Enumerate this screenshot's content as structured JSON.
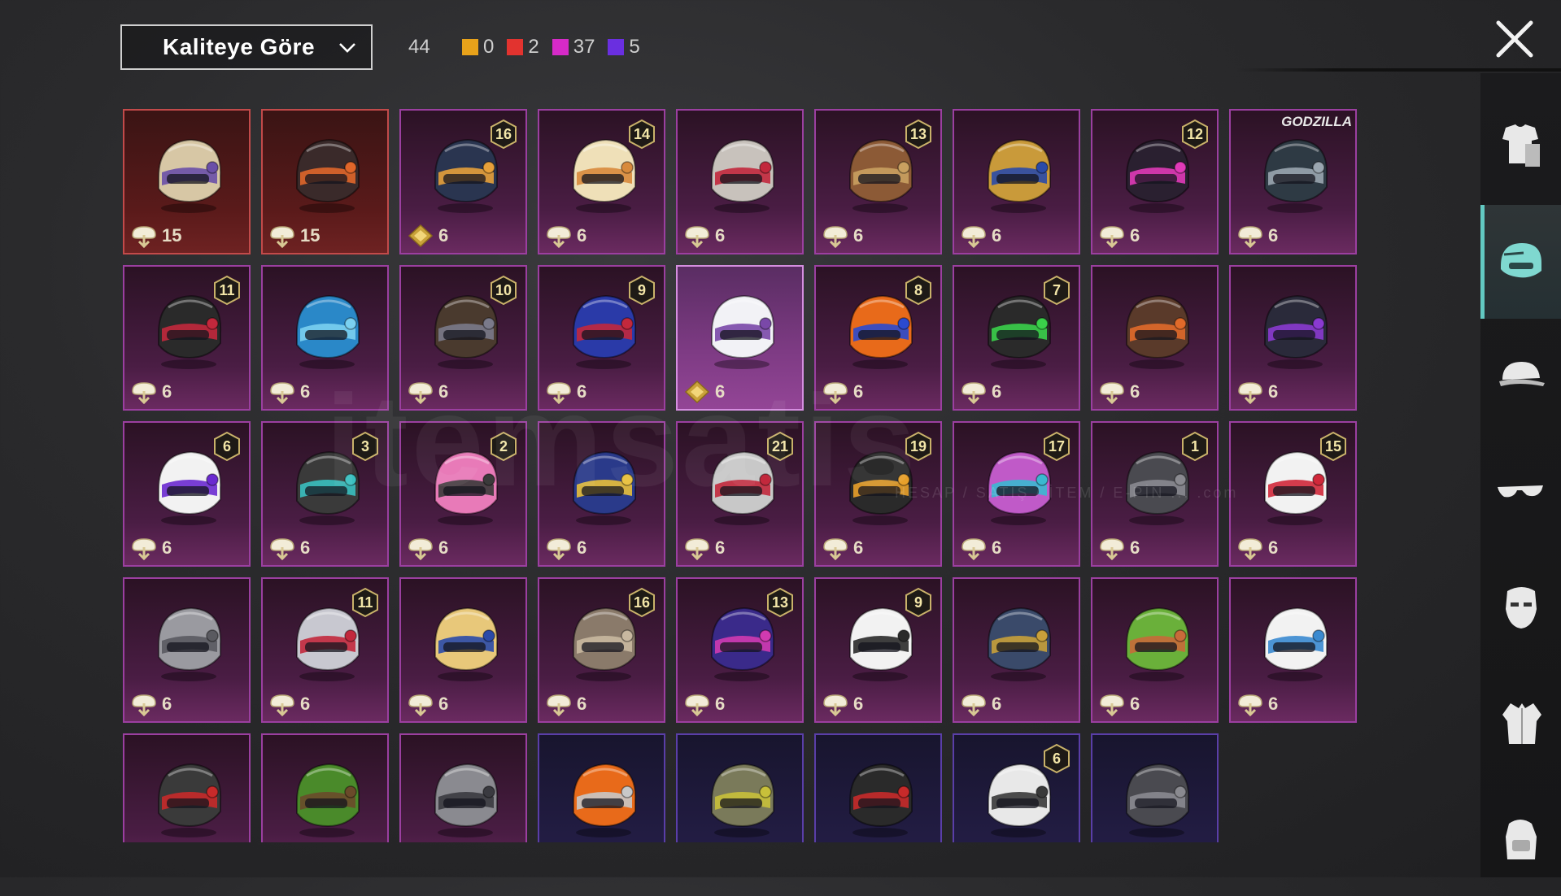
{
  "sort": {
    "label": "Kaliteye Göre"
  },
  "total_count": "44",
  "counts": [
    {
      "color": "#e8a21a",
      "value": "0"
    },
    {
      "color": "#e2332f",
      "value": "2"
    },
    {
      "color": "#d62ac8",
      "value": "37"
    },
    {
      "color": "#6a2fe0",
      "value": "5"
    }
  ],
  "items": [
    {
      "rarity": "red",
      "price": "15",
      "currency": "crate",
      "level": "",
      "colors": [
        "#d7c7a5",
        "#6a4fa8"
      ]
    },
    {
      "rarity": "red",
      "price": "15",
      "currency": "crate",
      "level": "",
      "colors": [
        "#3a2a2a",
        "#e0662a"
      ]
    },
    {
      "rarity": "purple",
      "price": "6",
      "currency": "diamond",
      "level": "16",
      "colors": [
        "#2a3550",
        "#e6a03a"
      ]
    },
    {
      "rarity": "purple",
      "price": "6",
      "currency": "crate",
      "level": "14",
      "colors": [
        "#efe0b8",
        "#d88a3c"
      ]
    },
    {
      "rarity": "purple",
      "price": "6",
      "currency": "crate",
      "level": "",
      "colors": [
        "#c8c2bc",
        "#c2283c"
      ]
    },
    {
      "rarity": "purple",
      "price": "6",
      "currency": "crate",
      "level": "13",
      "colors": [
        "#8c5a36",
        "#c9a060"
      ]
    },
    {
      "rarity": "purple",
      "price": "6",
      "currency": "crate",
      "level": "",
      "colors": [
        "#c99a3a",
        "#2a4aa8"
      ]
    },
    {
      "rarity": "purple",
      "price": "6",
      "currency": "crate",
      "level": "12",
      "colors": [
        "#2a2030",
        "#e03ab8"
      ]
    },
    {
      "rarity": "purple",
      "price": "6",
      "currency": "crate",
      "level": "",
      "brand": "GODZILLA",
      "colors": [
        "#2e3a44",
        "#9aa6b0"
      ]
    },
    {
      "rarity": "purple",
      "price": "6",
      "currency": "crate",
      "level": "11",
      "colors": [
        "#2a2a2a",
        "#c2283c"
      ]
    },
    {
      "rarity": "purple",
      "price": "6",
      "currency": "crate",
      "level": "",
      "colors": [
        "#2a88c8",
        "#7ad0f0"
      ]
    },
    {
      "rarity": "purple",
      "price": "6",
      "currency": "crate",
      "level": "10",
      "colors": [
        "#4a3a2e",
        "#7a7a8a"
      ]
    },
    {
      "rarity": "purple",
      "price": "6",
      "currency": "crate",
      "level": "9",
      "colors": [
        "#2a3aa8",
        "#c2283c"
      ]
    },
    {
      "rarity": "purple",
      "price": "6",
      "currency": "diamond",
      "level": "",
      "selected": true,
      "colors": [
        "#f2f2f6",
        "#7a48a8"
      ]
    },
    {
      "rarity": "purple",
      "price": "6",
      "currency": "crate",
      "level": "8",
      "colors": [
        "#e86a1a",
        "#2a4ad0"
      ]
    },
    {
      "rarity": "purple",
      "price": "6",
      "currency": "crate",
      "level": "7",
      "colors": [
        "#2a2a2a",
        "#3ad04a"
      ]
    },
    {
      "rarity": "purple",
      "price": "6",
      "currency": "crate",
      "level": "",
      "colors": [
        "#5a3a2a",
        "#e06a2a"
      ]
    },
    {
      "rarity": "purple",
      "price": "6",
      "currency": "crate",
      "level": "",
      "colors": [
        "#2a2a3a",
        "#8a3ad0"
      ]
    },
    {
      "rarity": "purple",
      "price": "6",
      "currency": "crate",
      "level": "6",
      "colors": [
        "#f2f2f2",
        "#6a2ad0"
      ]
    },
    {
      "rarity": "purple",
      "price": "6",
      "currency": "crate",
      "level": "3",
      "colors": [
        "#3a3a3a",
        "#3ac0c0"
      ]
    },
    {
      "rarity": "purple",
      "price": "6",
      "currency": "crate",
      "level": "2",
      "colors": [
        "#e87ab8",
        "#3a3a3a"
      ]
    },
    {
      "rarity": "purple",
      "price": "6",
      "currency": "crate",
      "level": "",
      "colors": [
        "#2a3a8a",
        "#e8c03a"
      ]
    },
    {
      "rarity": "purple",
      "price": "6",
      "currency": "crate",
      "level": "21",
      "colors": [
        "#c8c8c8",
        "#c2283c"
      ]
    },
    {
      "rarity": "purple",
      "price": "6",
      "currency": "crate",
      "level": "19",
      "colors": [
        "#2a2a2a",
        "#e8a02a"
      ]
    },
    {
      "rarity": "purple",
      "price": "6",
      "currency": "crate",
      "level": "17",
      "colors": [
        "#c05ac8",
        "#3ab8d0"
      ]
    },
    {
      "rarity": "purple",
      "price": "6",
      "currency": "crate",
      "level": "1",
      "colors": [
        "#4a4a50",
        "#8a8a90"
      ]
    },
    {
      "rarity": "purple",
      "price": "6",
      "currency": "crate",
      "level": "15",
      "colors": [
        "#f2f2f2",
        "#d0283a"
      ]
    },
    {
      "rarity": "purple",
      "price": "6",
      "currency": "crate",
      "level": "",
      "colors": [
        "#9a9aa0",
        "#5a5a60"
      ]
    },
    {
      "rarity": "purple",
      "price": "6",
      "currency": "crate",
      "level": "11",
      "colors": [
        "#c8c8d0",
        "#c2283c"
      ]
    },
    {
      "rarity": "purple",
      "price": "6",
      "currency": "crate",
      "level": "",
      "colors": [
        "#e8c87a",
        "#2a4aa8"
      ]
    },
    {
      "rarity": "purple",
      "price": "6",
      "currency": "crate",
      "level": "16",
      "colors": [
        "#8a7a6a",
        "#c8b8a0"
      ]
    },
    {
      "rarity": "purple",
      "price": "6",
      "currency": "crate",
      "level": "13",
      "colors": [
        "#3a2a8a",
        "#d03ab0"
      ]
    },
    {
      "rarity": "purple",
      "price": "6",
      "currency": "crate",
      "level": "9",
      "colors": [
        "#f2f2f2",
        "#2a2a2a"
      ]
    },
    {
      "rarity": "purple",
      "price": "6",
      "currency": "crate",
      "level": "",
      "colors": [
        "#3a4a6a",
        "#c8a03a"
      ]
    },
    {
      "rarity": "purple",
      "price": "6",
      "currency": "crate",
      "level": "",
      "colors": [
        "#6ab03a",
        "#c86a3a"
      ]
    },
    {
      "rarity": "purple",
      "price": "6",
      "currency": "crate",
      "level": "",
      "colors": [
        "#f2f2f2",
        "#3a8ad0"
      ]
    },
    {
      "rarity": "purple",
      "price": "",
      "currency": "",
      "level": "",
      "colors": [
        "#3a3a3a",
        "#c82a2a"
      ]
    },
    {
      "rarity": "purple",
      "price": "",
      "currency": "",
      "level": "",
      "colors": [
        "#4a8a2a",
        "#6a4a2a"
      ]
    },
    {
      "rarity": "purple",
      "price": "",
      "currency": "",
      "level": "",
      "colors": [
        "#8a8a90",
        "#3a3a40"
      ]
    },
    {
      "rarity": "blue",
      "price": "",
      "currency": "",
      "level": "",
      "colors": [
        "#e86a1a",
        "#c8c8c8"
      ]
    },
    {
      "rarity": "blue",
      "price": "",
      "currency": "",
      "level": "",
      "colors": [
        "#7a7a5a",
        "#c8c03a"
      ]
    },
    {
      "rarity": "blue",
      "price": "",
      "currency": "",
      "level": "",
      "colors": [
        "#2a2a2a",
        "#c82a2a"
      ]
    },
    {
      "rarity": "blue",
      "price": "",
      "currency": "",
      "level": "6",
      "colors": [
        "#e8e8e8",
        "#3a3a3a"
      ]
    },
    {
      "rarity": "blue",
      "price": "",
      "currency": "",
      "level": "",
      "colors": [
        "#4a4a50",
        "#8a8a90"
      ]
    }
  ],
  "sidebar": [
    {
      "name": "outfit-icon"
    },
    {
      "name": "helmet-icon",
      "active": true
    },
    {
      "name": "cap-icon"
    },
    {
      "name": "glasses-icon"
    },
    {
      "name": "mask-icon"
    },
    {
      "name": "jacket-icon"
    },
    {
      "name": "backpack-icon"
    }
  ],
  "watermark": {
    "text": "itemsatis",
    "sub": "HESAP / SATIŞ / İTEM / E-PİN ... .com"
  }
}
